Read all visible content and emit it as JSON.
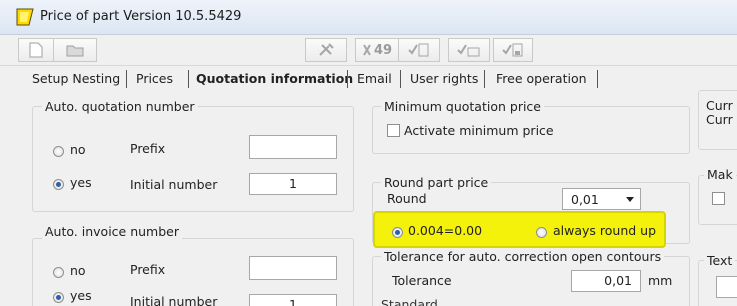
{
  "window": {
    "title": "Price of part Version 10.5.5429"
  },
  "toolbar": {
    "icons": [
      "new-document-icon",
      "open-folder-icon",
      "tools-icon",
      "disabled-action-icon",
      "check-list-icon",
      "check-more-icon",
      "check-save-icon"
    ],
    "label_49": "49"
  },
  "tabs": [
    {
      "label": "Setup Nesting",
      "active": false
    },
    {
      "label": "Prices",
      "active": false
    },
    {
      "label": "Quotation information",
      "active": true
    },
    {
      "label": "Email",
      "active": false
    },
    {
      "label": "User rights",
      "active": false
    },
    {
      "label": "Free operation",
      "active": false
    }
  ],
  "auto_quotation": {
    "legend": "Auto. quotation number",
    "no_label": "no",
    "yes_label": "yes",
    "selected": "yes",
    "prefix_label": "Prefix",
    "prefix_value": "",
    "initial_label": "Initial number",
    "initial_value": "1"
  },
  "auto_invoice": {
    "legend": "Auto. invoice number",
    "no_label": "no",
    "yes_label": "yes",
    "selected": "yes",
    "prefix_label": "Prefix",
    "prefix_value": "",
    "initial_label": "Initial number",
    "initial_value": "1"
  },
  "min_price": {
    "legend": "Minimum quotation price",
    "checkbox_label": "Activate minimum price",
    "checked": false
  },
  "round_price": {
    "legend": "Round part price",
    "round_label": "Round",
    "round_value": "0,01",
    "option_a": "0.004=0.00",
    "option_b": "always round up",
    "selected": "option_a"
  },
  "tolerance": {
    "legend": "Tolerance for auto. correction open contours",
    "label": "Tolerance",
    "value": "0,01",
    "unit": "mm"
  },
  "partial_below": {
    "label": "Standard"
  },
  "right_clip": {
    "cur1": "Curr",
    "cur2": "Curr",
    "mak": "Mak",
    "text": "Text"
  },
  "colors": {
    "highlight": "#f4f20a",
    "radio_dot": "#2f5fa8"
  }
}
